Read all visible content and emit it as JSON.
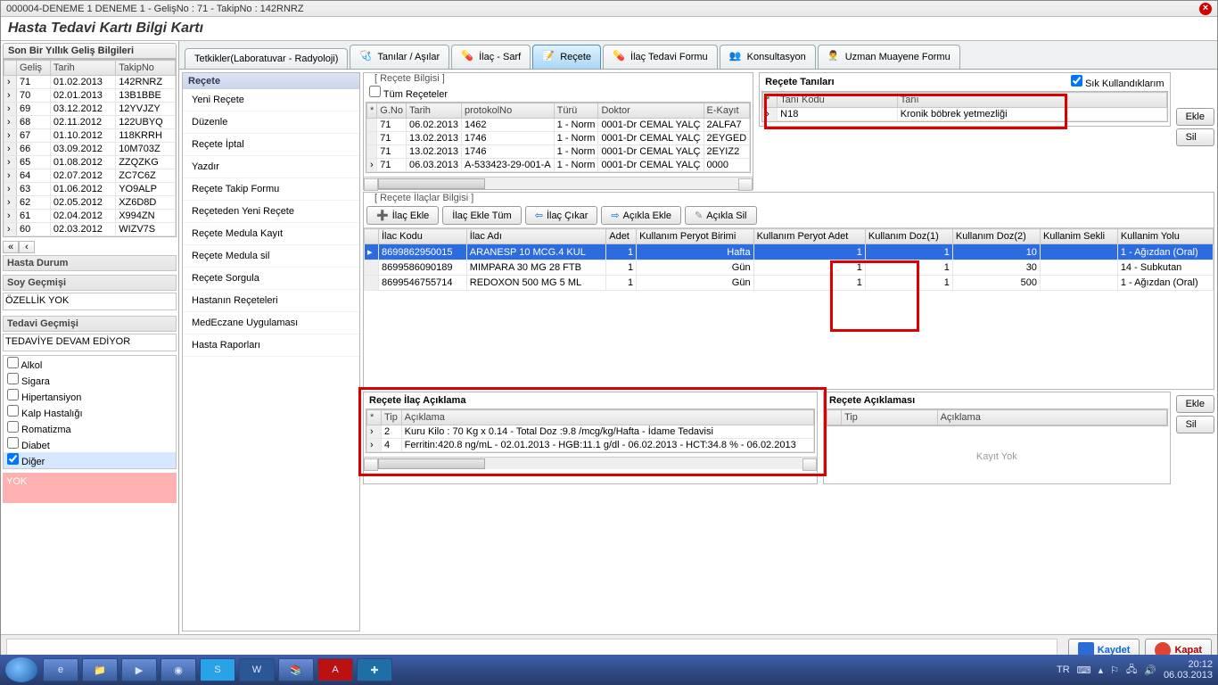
{
  "window_title": "000004-DENEME 1 DENEME 1 - GelişNo : 71 - TakipNo : 142RNRZ",
  "page_header": "Hasta Tedavi Kartı Bilgi Kartı",
  "visits": {
    "title": "Son Bir Yıllık Geliş Bilgileri",
    "cols": [
      "Geliş",
      "Tarih",
      "TakipNo"
    ],
    "rows": [
      [
        "71",
        "01.02.2013",
        "142RNRZ"
      ],
      [
        "70",
        "02.01.2013",
        "13B1BBE"
      ],
      [
        "69",
        "03.12.2012",
        "12YVJZY"
      ],
      [
        "68",
        "02.11.2012",
        "122UBYQ"
      ],
      [
        "67",
        "01.10.2012",
        "118KRRH"
      ],
      [
        "66",
        "03.09.2012",
        "10M703Z"
      ],
      [
        "65",
        "01.08.2012",
        "ZZQZKG"
      ],
      [
        "64",
        "02.07.2012",
        "ZC7C6Z"
      ],
      [
        "63",
        "01.06.2012",
        "YO9ALP"
      ],
      [
        "62",
        "02.05.2012",
        "XZ6D8D"
      ],
      [
        "61",
        "02.04.2012",
        "X994ZN"
      ],
      [
        "60",
        "02.03.2012",
        "WIZV7S"
      ]
    ]
  },
  "hasta_durum_label": "Hasta Durum",
  "soy_gecmisi": {
    "label": "Soy Geçmişi",
    "value": "ÖZELLİK YOK"
  },
  "tedavi_gecmisi": {
    "label": "Tedavi Geçmişi",
    "value": "TEDAVİYE DEVAM EDİYOR"
  },
  "risk_checks": [
    {
      "label": "Alkol",
      "checked": false
    },
    {
      "label": "Sigara",
      "checked": false
    },
    {
      "label": "Hipertansiyon",
      "checked": false
    },
    {
      "label": "Kalp Hastalığı",
      "checked": false
    },
    {
      "label": "Romatizma",
      "checked": false
    },
    {
      "label": "Diabet",
      "checked": false
    },
    {
      "label": "Diğer",
      "checked": true
    }
  ],
  "pink_text": "YOK",
  "tabs": [
    "Tetkikler(Laboratuvar - Radyoloji)",
    "Tanılar / Aşılar",
    "İlaç - Sarf",
    "Reçete",
    "İlaç Tedavi Formu",
    "Konsultasyon",
    "Uzman Muayene Formu"
  ],
  "active_tab": 3,
  "menu": {
    "title": "Reçete",
    "items": [
      "Yeni Reçete",
      "Düzenle",
      "Reçete İptal",
      "Yazdır",
      "Reçete Takip Formu",
      "Reçeteden Yeni Reçete",
      "Reçete Medula Kayıt",
      "Reçete Medula sil",
      "Reçete Sorgula",
      "Hastanın Reçeteleri",
      "MedEczane Uygulaması",
      "Hasta Raporları"
    ]
  },
  "recete_bilgisi": {
    "group": "[ Reçete Bilgisi ]",
    "tum_label": "Tüm Reçeteler",
    "tum_checked": false,
    "cols": [
      "G.No",
      "Tarih",
      "protokolNo",
      "Türü",
      "Doktor",
      "E-Kayıt"
    ],
    "rows": [
      [
        "71",
        "06.02.2013",
        "1462",
        "1 - Norm",
        "0001-Dr CEMAL YALÇ",
        "2ALFA7"
      ],
      [
        "71",
        "13.02.2013",
        "1746",
        "1 - Norm",
        "0001-Dr CEMAL YALÇ",
        "2EYGED"
      ],
      [
        "71",
        "13.02.2013",
        "1746",
        "1 - Norm",
        "0001-Dr CEMAL YALÇ",
        "2EYIZ2"
      ],
      [
        "71",
        "06.03.2013",
        "A-533423-29-001-A",
        "1 - Norm",
        "0001-Dr CEMAL YALÇ",
        "0000"
      ]
    ]
  },
  "tanilar": {
    "title": "Reçete Tanıları",
    "sik_label": "Sık Kullandıklarım",
    "sik_checked": true,
    "cols": [
      "Tanı Kodu",
      "Tanı"
    ],
    "rows": [
      [
        "N18",
        "Kronik böbrek yetmezliği"
      ]
    ]
  },
  "side_buttons": {
    "ekle": "Ekle",
    "sil": "Sil"
  },
  "ilac": {
    "group": "[ Reçete İlaçlar Bilgisi ]",
    "buttons": {
      "ilac_ekle": "İlaç Ekle",
      "ilac_ekle_tum": "İlaç Ekle Tüm",
      "ilac_cikar": "İlaç Çıkar",
      "acikla_ekle": "Açıkla Ekle",
      "acikla_sil": "Açıkla Sil"
    },
    "cols": [
      "İlac Kodu",
      "İlac Adı",
      "Adet",
      "Kullanım Peryot Birimi",
      "Kullanım Peryot Adet",
      "Kullanım Doz(1)",
      "Kullanım Doz(2)",
      "Kullanim Sekli",
      "Kullanim Yolu"
    ],
    "rows": [
      {
        "sel": true,
        "c": [
          "8699862950015",
          "ARANESP 10 MCG.4 KUL",
          "1",
          "Hafta",
          "1",
          "1",
          "10",
          "",
          "1 - Ağızdan (Oral)"
        ]
      },
      {
        "sel": false,
        "c": [
          "8699586090189",
          "MIMPARA 30 MG 28 FTB",
          "1",
          "Gün",
          "1",
          "1",
          "30",
          "",
          "14 - Subkutan"
        ]
      },
      {
        "sel": false,
        "c": [
          "8699546755714",
          "REDOXON 500 MG 5 ML",
          "1",
          "Gün",
          "1",
          "1",
          "500",
          "",
          "1 - Ağızdan (Oral)"
        ]
      }
    ]
  },
  "ilac_aciklama": {
    "title": "Reçete İlaç Açıklama",
    "cols": [
      "Tip",
      "Açıklama"
    ],
    "rows": [
      [
        "2",
        "Kuru Kilo : 70 Kg x 0.14 - Total Doz :9.8 /mcg/kg/Hafta - İdame Tedavisi"
      ],
      [
        "4",
        "Ferritin:420.8 ng/mL - 02.01.2013 - HGB:11.1 g/dl - 06.02.2013 - HCT:34.8 % - 06.02.2013"
      ]
    ]
  },
  "recete_aciklama": {
    "title": "Reçete Açıklaması",
    "cols": [
      "Tip",
      "Açıklama"
    ],
    "empty": "Kayıt Yok"
  },
  "footer": {
    "kaydet": "Kaydet",
    "kapat": "Kapat"
  },
  "taskbar": {
    "lang": "TR",
    "time": "20:12",
    "date": "06.03.2013"
  }
}
